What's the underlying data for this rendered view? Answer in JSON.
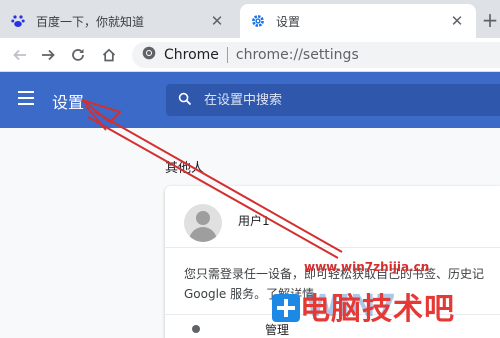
{
  "tabs": [
    {
      "title": "百度一下，你就知道",
      "active": false,
      "icon": "baidu-paw-icon"
    },
    {
      "title": "设置",
      "active": true,
      "icon": "settings-gear-icon"
    }
  ],
  "toolbar": {
    "omnibox_label": "Chrome",
    "url": "chrome://settings"
  },
  "settings": {
    "title": "设置",
    "search_placeholder": "在设置中搜索"
  },
  "people": {
    "section_title": "其他人",
    "profile_name": "用户1",
    "sync_text_line1": "您只需登录任一设备，即可轻松获取自己的书签、历史记",
    "sync_text_line2": "Google 服务。了解详情",
    "next_row_label": "管理"
  },
  "watermark": {
    "url": "www.win7zhijia.cn",
    "brand": "电脑技术吧"
  },
  "colors": {
    "header_blue": "#3b6ac9",
    "search_blue": "#2f58ad",
    "annotation_red": "#d32f2f"
  }
}
